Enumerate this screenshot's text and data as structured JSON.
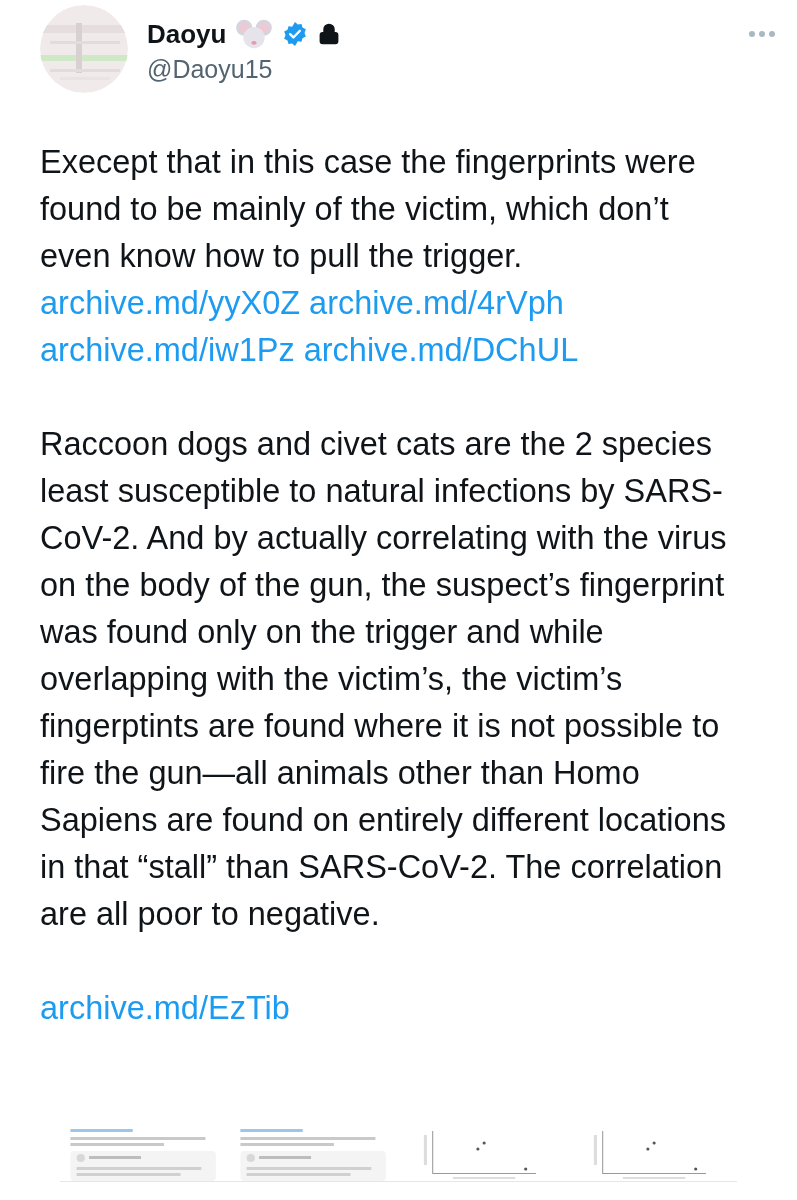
{
  "author": {
    "name": "Daoyu",
    "handle": "@Daoyu15",
    "verified": true,
    "protected": true
  },
  "paragraphs": [
    {
      "text": "Execept that in this case the fingerprints were found to be mainly of the victim, which don’t even know how to pull the trigger.",
      "links": [
        "archive.md/yyX0Z",
        "archive.md/4rVph",
        "archive.md/iw1Pz",
        "archive.md/DChUL"
      ]
    },
    {
      "text": "Raccoon dogs and civet cats are the 2 species least susceptible to natural infections by SARS-CoV-2. And by actually correlating with the virus on the body of the gun, the suspect’s fingerprint was found only on the trigger and while overlapping with the victim’s, the victim’s fingerptints are found where it is not possible to fire the gun—all animals other than Homo Sapiens are found on entirely different locations in that “stall” than SARS-CoV-2. The correlation are all poor to negative."
    },
    {
      "links": [
        "archive.md/EzTib"
      ]
    }
  ]
}
